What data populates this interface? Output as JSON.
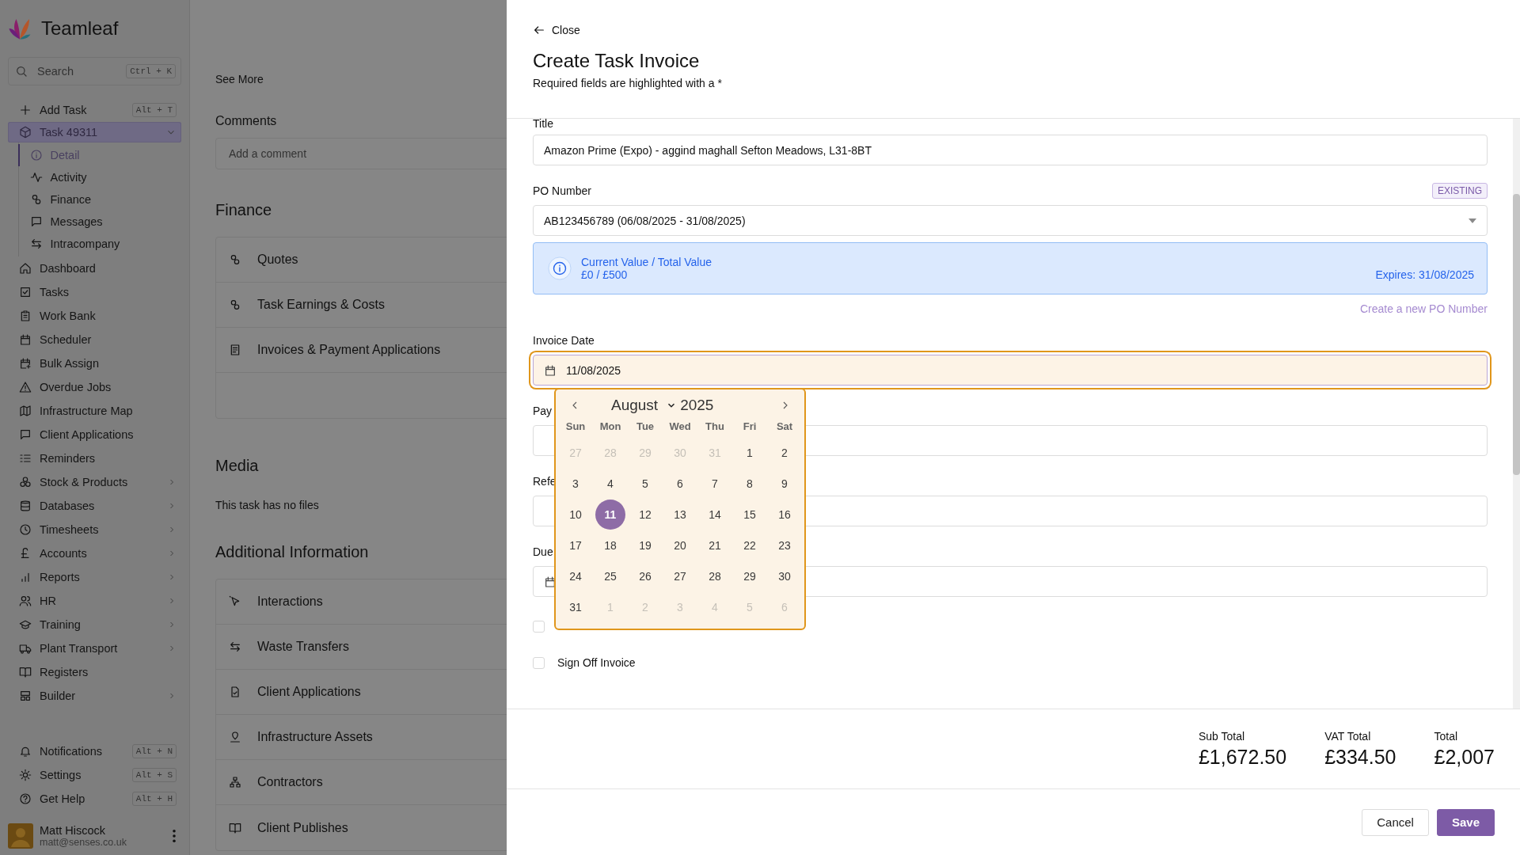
{
  "sidebar": {
    "brand": "Teamleaf",
    "search": {
      "placeholder": "Search",
      "shortcut": "Ctrl + K"
    },
    "actions": [
      {
        "label": "Add Task",
        "shortcut": "Alt + T"
      }
    ],
    "task": {
      "label": "Task 49311",
      "expanded": true,
      "selected": true,
      "children": [
        {
          "label": "Detail",
          "selected": true
        },
        {
          "label": "Activity",
          "selected": false
        },
        {
          "label": "Finance",
          "selected": false
        },
        {
          "label": "Messages",
          "selected": false
        },
        {
          "label": "Intracompany",
          "selected": false
        }
      ]
    },
    "items": [
      {
        "label": "Dashboard",
        "has_submenu": false,
        "selected": false
      },
      {
        "label": "Tasks",
        "has_submenu": false,
        "selected": false
      },
      {
        "label": "Work Bank",
        "has_submenu": false,
        "selected": false
      },
      {
        "label": "Scheduler",
        "has_submenu": false,
        "selected": false
      },
      {
        "label": "Bulk Assign",
        "has_submenu": false,
        "selected": false
      },
      {
        "label": "Overdue Jobs",
        "has_submenu": false,
        "selected": false
      },
      {
        "label": "Infrastructure Map",
        "has_submenu": false,
        "selected": false
      },
      {
        "label": "Client Applications",
        "has_submenu": false,
        "selected": false
      },
      {
        "label": "Reminders",
        "has_submenu": false,
        "selected": false
      },
      {
        "label": "Stock & Products",
        "has_submenu": true,
        "selected": false
      },
      {
        "label": "Databases",
        "has_submenu": true,
        "selected": false
      },
      {
        "label": "Timesheets",
        "has_submenu": true,
        "selected": false
      },
      {
        "label": "Accounts",
        "has_submenu": true,
        "selected": false
      },
      {
        "label": "Reports",
        "has_submenu": true,
        "selected": false
      },
      {
        "label": "HR",
        "has_submenu": true,
        "selected": false
      },
      {
        "label": "Training",
        "has_submenu": true,
        "selected": false
      },
      {
        "label": "Plant Transport",
        "has_submenu": true,
        "selected": false
      },
      {
        "label": "Registers",
        "has_submenu": false,
        "selected": false
      },
      {
        "label": "Builder",
        "has_submenu": true,
        "selected": false
      }
    ],
    "bottom_items": [
      {
        "label": "Notifications",
        "shortcut": "Alt + N"
      },
      {
        "label": "Settings",
        "shortcut": "Alt + S"
      },
      {
        "label": "Get Help",
        "shortcut": "Alt + H"
      }
    ],
    "user": {
      "name": "Matt Hiscock",
      "email": "matt@senses.co.uk"
    }
  },
  "background_page": {
    "see_more": "See More",
    "comments": {
      "heading": "Comments",
      "placeholder": "Add a comment"
    },
    "finance": {
      "heading": "Finance",
      "items": [
        "Quotes",
        "Task Earnings & Costs",
        "Invoices & Payment Applications"
      ]
    },
    "media": {
      "heading": "Media",
      "empty_text": "This task has no files"
    },
    "additional_information": {
      "heading": "Additional Information",
      "items": [
        "Interactions",
        "Waste Transfers",
        "Client Applications",
        "Infrastructure Assets",
        "Contractors",
        "Client Publishes"
      ]
    }
  },
  "drawer": {
    "close": "Close",
    "title": "Create Task Invoice",
    "subtitle": "Required fields are highlighted with a *",
    "form": {
      "title": {
        "label": "Title",
        "value": "Amazon Prime (Expo) - aggind maghall Sefton Meadows, L31-8BT"
      },
      "po_number": {
        "label": "PO Number",
        "badge": "EXISTING",
        "value": "AB123456789 (06/08/2025 - 31/08/2025)"
      },
      "po_info": {
        "heading": "Current Value / Total Value",
        "amount": "£0 / £500",
        "expires": "Expires: 31/08/2025"
      },
      "create_po_link": "Create a new PO Number",
      "invoice_date": {
        "label": "Invoice Date",
        "value": "11/08/2025",
        "focused": true
      },
      "payment": {
        "label": "Pay"
      },
      "reference": {
        "label": "Refe"
      },
      "due": {
        "label": "Due"
      },
      "checkboxes": [
        {
          "checked": false
        },
        {
          "label": "Sign Off Invoice",
          "checked": false
        }
      ]
    },
    "date_picker": {
      "month": "August",
      "year": "2025",
      "weekdays": [
        "Sun",
        "Mon",
        "Tue",
        "Wed",
        "Thu",
        "Fri",
        "Sat"
      ],
      "weeks": [
        [
          {
            "day": "27",
            "in_month": false,
            "selected": false
          },
          {
            "day": "28",
            "in_month": false,
            "selected": false
          },
          {
            "day": "29",
            "in_month": false,
            "selected": false
          },
          {
            "day": "30",
            "in_month": false,
            "selected": false
          },
          {
            "day": "31",
            "in_month": false,
            "selected": false
          },
          {
            "day": "1",
            "in_month": true,
            "selected": false
          },
          {
            "day": "2",
            "in_month": true,
            "selected": false
          }
        ],
        [
          {
            "day": "3",
            "in_month": true,
            "selected": false
          },
          {
            "day": "4",
            "in_month": true,
            "selected": false
          },
          {
            "day": "5",
            "in_month": true,
            "selected": false
          },
          {
            "day": "6",
            "in_month": true,
            "selected": false
          },
          {
            "day": "7",
            "in_month": true,
            "selected": false
          },
          {
            "day": "8",
            "in_month": true,
            "selected": false
          },
          {
            "day": "9",
            "in_month": true,
            "selected": false
          }
        ],
        [
          {
            "day": "10",
            "in_month": true,
            "selected": false
          },
          {
            "day": "11",
            "in_month": true,
            "selected": true
          },
          {
            "day": "12",
            "in_month": true,
            "selected": false
          },
          {
            "day": "13",
            "in_month": true,
            "selected": false
          },
          {
            "day": "14",
            "in_month": true,
            "selected": false
          },
          {
            "day": "15",
            "in_month": true,
            "selected": false
          },
          {
            "day": "16",
            "in_month": true,
            "selected": false
          }
        ],
        [
          {
            "day": "17",
            "in_month": true,
            "selected": false
          },
          {
            "day": "18",
            "in_month": true,
            "selected": false
          },
          {
            "day": "19",
            "in_month": true,
            "selected": false
          },
          {
            "day": "20",
            "in_month": true,
            "selected": false
          },
          {
            "day": "21",
            "in_month": true,
            "selected": false
          },
          {
            "day": "22",
            "in_month": true,
            "selected": false
          },
          {
            "day": "23",
            "in_month": true,
            "selected": false
          }
        ],
        [
          {
            "day": "24",
            "in_month": true,
            "selected": false
          },
          {
            "day": "25",
            "in_month": true,
            "selected": false
          },
          {
            "day": "26",
            "in_month": true,
            "selected": false
          },
          {
            "day": "27",
            "in_month": true,
            "selected": false
          },
          {
            "day": "28",
            "in_month": true,
            "selected": false
          },
          {
            "day": "29",
            "in_month": true,
            "selected": false
          },
          {
            "day": "30",
            "in_month": true,
            "selected": false
          }
        ],
        [
          {
            "day": "31",
            "in_month": true,
            "selected": false
          },
          {
            "day": "1",
            "in_month": false,
            "selected": false
          },
          {
            "day": "2",
            "in_month": false,
            "selected": false
          },
          {
            "day": "3",
            "in_month": false,
            "selected": false
          },
          {
            "day": "4",
            "in_month": false,
            "selected": false
          },
          {
            "day": "5",
            "in_month": false,
            "selected": false
          },
          {
            "day": "6",
            "in_month": false,
            "selected": false
          }
        ]
      ]
    },
    "totals": [
      {
        "label": "Sub Total",
        "value": "£1,672.50"
      },
      {
        "label": "VAT Total",
        "value": "£334.50"
      },
      {
        "label": "Total",
        "value": "£2,007"
      }
    ],
    "buttons": [
      {
        "label": "Cancel",
        "kind": "secondary"
      },
      {
        "label": "Save",
        "kind": "primary"
      }
    ]
  }
}
